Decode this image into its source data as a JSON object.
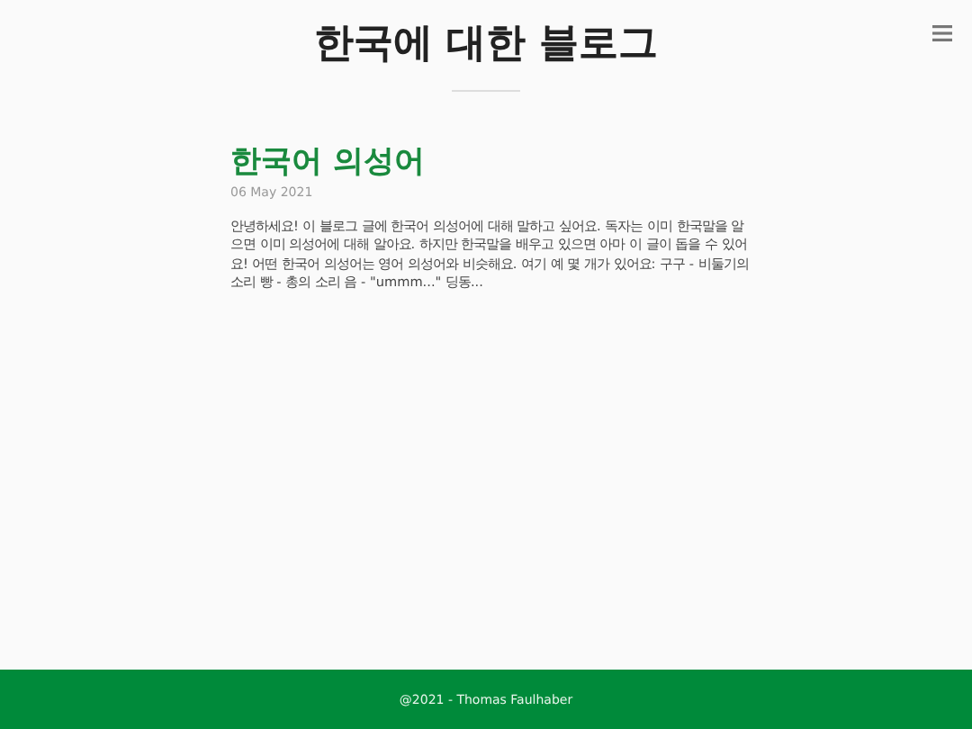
{
  "header": {
    "title": "한국에 대한 블로그"
  },
  "posts": [
    {
      "title": "한국어 의성어",
      "date": "06 May 2021",
      "excerpt": "안녕하세요! 이 블로그 글에 한국어 의성어에 대해 말하고 싶어요. 독자는 이미 한국말을 알으면 이미 의성어에 대해 알아요. 하지만 한국말을 배우고 있으면 아마 이 글이 돕을 수 있어요! 어떤 한국어 의성어는 영어 의성어와 비슷해요. 여기 예 몇 개가 있어요: 구구 - 비둘기의 소리 빵 - 총의 소리 음 - \"ummm...\" 딩동..."
    }
  ],
  "footer": {
    "text": "@2021 - Thomas Faulhaber"
  }
}
